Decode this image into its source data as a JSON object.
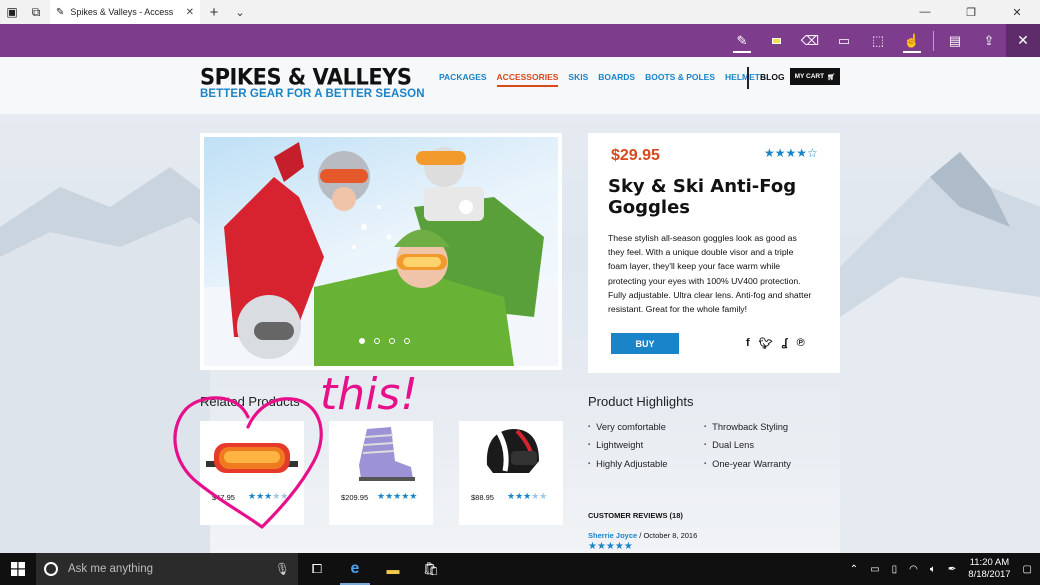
{
  "browser": {
    "tab_title": "Spikes & Valleys - Access",
    "ink_tools": [
      "ballpoint-pen-icon",
      "highlighter-icon",
      "eraser-icon",
      "add-note-icon",
      "clip-icon",
      "touch-writing-icon",
      "save-icon",
      "share-icon"
    ]
  },
  "site": {
    "logo_line1": "SPIKES & VALLEYS",
    "logo_line2": "BETTER GEAR FOR A BETTER SEASON",
    "nav": [
      "PACKAGES",
      "ACCESSORIES",
      "SKIS",
      "BOARDS",
      "BOOTS & POLES",
      "HELMETS"
    ],
    "nav_active_index": 1,
    "blog": "BLOG",
    "cart": "MY CART",
    "colors": {
      "accent_blue": "#1a84c9",
      "accent_orange": "#d8491b",
      "ink_purple": "#7d3c8c",
      "ink_pink": "#e8108a"
    }
  },
  "product": {
    "price": "$29.95",
    "stars": "★★★★☆",
    "rating": 4,
    "title": "Sky & Ski Anti-Fog Goggles",
    "description": "These stylish all-season goggles look as good as they feel. With a unique double visor and a triple foam layer, they'll keep your face warm while protecting your eyes with 100% UV400 protection. Fully adjustable. Ultra clear lens. Anti-fog and shatter resistant. Great for the whole family!",
    "buy": "BUY",
    "share": [
      "facebook-icon",
      "twitter-icon",
      "stumbleupon-icon",
      "pinterest-icon"
    ],
    "carousel_slides": 4,
    "carousel_active": 0
  },
  "related": {
    "title": "Related Products",
    "items": [
      {
        "name": "goggles",
        "price": "$47.95",
        "rating": 3
      },
      {
        "name": "ski-boot",
        "price": "$209.95",
        "rating": 5
      },
      {
        "name": "helmet",
        "price": "$88.95",
        "rating": 3
      }
    ]
  },
  "highlights": {
    "title": "Product Highlights",
    "col1": [
      "Very comfortable",
      "Lightweight",
      "Highly Adjustable"
    ],
    "col2": [
      "Throwback Styling",
      "Dual Lens",
      "One-year Warranty"
    ]
  },
  "reviews": {
    "header": "CUSTOMER REVIEWS (18)",
    "reviewer": "Sherrie Joyce",
    "date": "/ October 8, 2016",
    "stars": "★★★★★"
  },
  "annotation": {
    "text": "this!"
  },
  "taskbar": {
    "search_placeholder": "Ask me anything",
    "time": "11:20 AM",
    "date": "8/18/2017"
  }
}
